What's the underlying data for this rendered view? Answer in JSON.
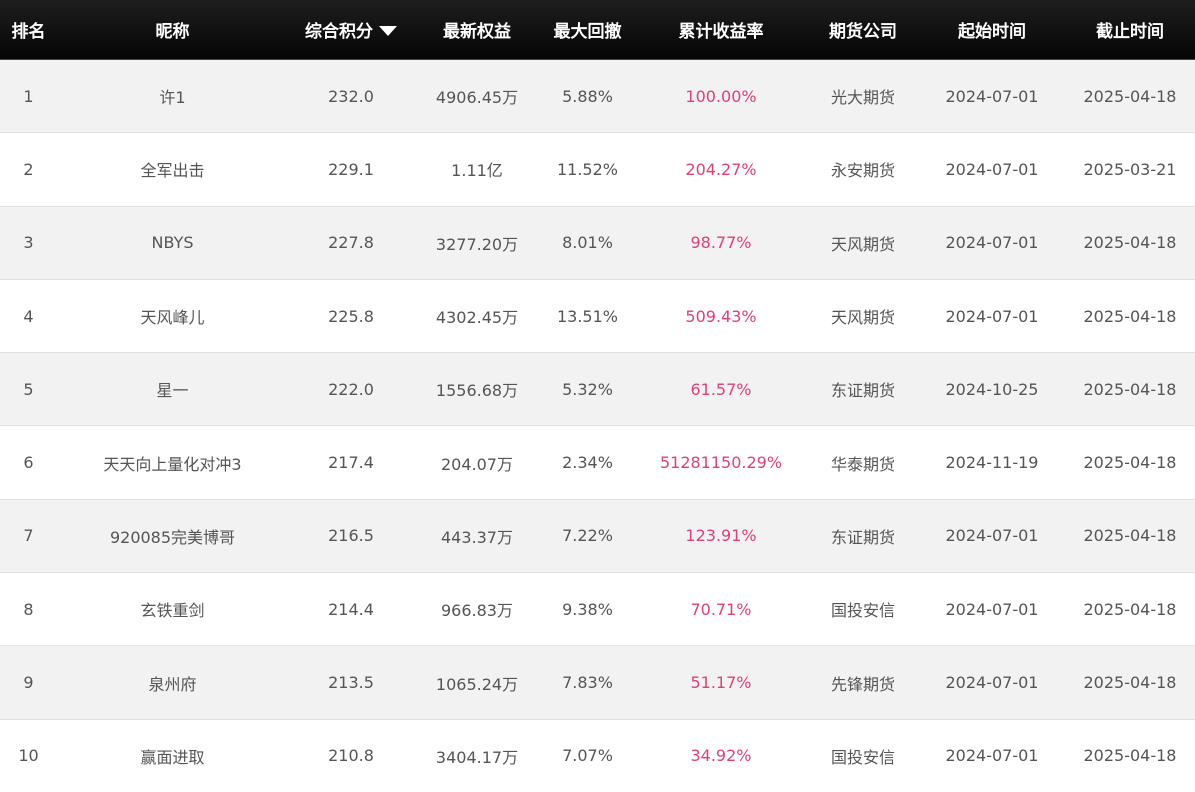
{
  "header": {
    "rank": "排名",
    "nickname": "昵称",
    "score": "综合积分",
    "equity": "最新权益",
    "drawdown": "最大回撤",
    "return": "累计收益率",
    "company": "期货公司",
    "start": "起始时间",
    "end": "截止时间",
    "sort_icon": "caret-down-icon"
  },
  "colors": {
    "header_bg": "#111111",
    "return_color": "#e0407a",
    "stripe": "#f2f2f2"
  },
  "rows": [
    {
      "rank": "1",
      "name": "许1",
      "score": "232.0",
      "equity": "4906.45万",
      "drawdown": "5.88%",
      "return": "100.00%",
      "company": "光大期货",
      "start": "2024-07-01",
      "end": "2025-04-18"
    },
    {
      "rank": "2",
      "name": "全军出击",
      "score": "229.1",
      "equity": "1.11亿",
      "drawdown": "11.52%",
      "return": "204.27%",
      "company": "永安期货",
      "start": "2024-07-01",
      "end": "2025-03-21"
    },
    {
      "rank": "3",
      "name": "NBYS",
      "score": "227.8",
      "equity": "3277.20万",
      "drawdown": "8.01%",
      "return": "98.77%",
      "company": "天风期货",
      "start": "2024-07-01",
      "end": "2025-04-18"
    },
    {
      "rank": "4",
      "name": "天风峰儿",
      "score": "225.8",
      "equity": "4302.45万",
      "drawdown": "13.51%",
      "return": "509.43%",
      "company": "天风期货",
      "start": "2024-07-01",
      "end": "2025-04-18"
    },
    {
      "rank": "5",
      "name": "星一",
      "score": "222.0",
      "equity": "1556.68万",
      "drawdown": "5.32%",
      "return": "61.57%",
      "company": "东证期货",
      "start": "2024-10-25",
      "end": "2025-04-18"
    },
    {
      "rank": "6",
      "name": "天天向上量化对冲3",
      "score": "217.4",
      "equity": "204.07万",
      "drawdown": "2.34%",
      "return": "51281150.29%",
      "company": "华泰期货",
      "start": "2024-11-19",
      "end": "2025-04-18"
    },
    {
      "rank": "7",
      "name": "920085完美博哥",
      "score": "216.5",
      "equity": "443.37万",
      "drawdown": "7.22%",
      "return": "123.91%",
      "company": "东证期货",
      "start": "2024-07-01",
      "end": "2025-04-18"
    },
    {
      "rank": "8",
      "name": "玄铁重剑",
      "score": "214.4",
      "equity": "966.83万",
      "drawdown": "9.38%",
      "return": "70.71%",
      "company": "国投安信",
      "start": "2024-07-01",
      "end": "2025-04-18"
    },
    {
      "rank": "9",
      "name": "泉州府",
      "score": "213.5",
      "equity": "1065.24万",
      "drawdown": "7.83%",
      "return": "51.17%",
      "company": "先锋期货",
      "start": "2024-07-01",
      "end": "2025-04-18"
    },
    {
      "rank": "10",
      "name": "赢面进取",
      "score": "210.8",
      "equity": "3404.17万",
      "drawdown": "7.07%",
      "return": "34.92%",
      "company": "国投安信",
      "start": "2024-07-01",
      "end": "2025-04-18"
    }
  ]
}
